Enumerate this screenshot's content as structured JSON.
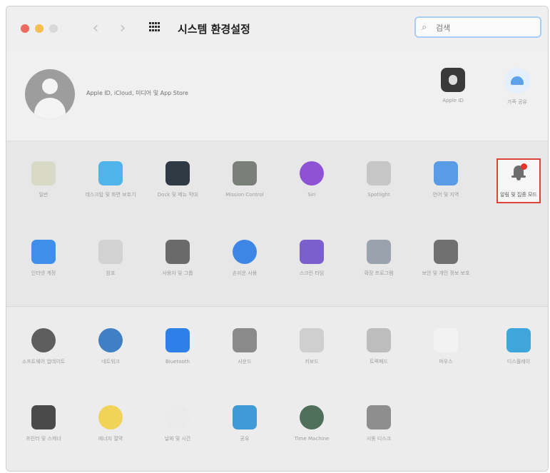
{
  "window": {
    "title": "시스템 환경설정",
    "back_glyph": "‹",
    "forward_glyph": "›"
  },
  "search": {
    "placeholder": "검색"
  },
  "account": {
    "description": "Apple ID, iCloud, 미디어 및 App Store",
    "icons": [
      {
        "label": "Apple ID",
        "icon": "apple-id-icon"
      },
      {
        "label": "가족 공유",
        "icon": "family-sharing-icon"
      }
    ]
  },
  "section1": {
    "row1": [
      {
        "label": "일반",
        "icon": "general-icon",
        "color": "#d9d9c8"
      },
      {
        "label": "데스크탑 및 화면 보호기",
        "icon": "desktop-screensaver-icon",
        "color": "#4fb4ea"
      },
      {
        "label": "Dock 및 메뉴 막대",
        "icon": "dock-menubar-icon",
        "color": "#2f3a45"
      },
      {
        "label": "Mission Control",
        "icon": "mission-control-icon",
        "color": "#7a7f7a"
      },
      {
        "label": "Siri",
        "icon": "siri-icon",
        "color": "#8e52d6"
      },
      {
        "label": "Spotlight",
        "icon": "spotlight-icon",
        "color": "#c6c6c6"
      },
      {
        "label": "언어 및 지역",
        "icon": "language-region-icon",
        "color": "#5a9be6"
      },
      {
        "label": "알림 및 집중 모드",
        "icon": "notifications-focus-icon",
        "color": "#6d6d6d"
      }
    ],
    "row2": [
      {
        "label": "인터넷 계정",
        "icon": "internet-accounts-icon",
        "color": "#3f8eea"
      },
      {
        "label": "암호",
        "icon": "passwords-icon",
        "color": "#d2d2d2"
      },
      {
        "label": "사용자 및 그룹",
        "icon": "users-groups-icon",
        "color": "#6a6a6a"
      },
      {
        "label": "손쉬운 사용",
        "icon": "accessibility-icon",
        "color": "#3d86e6"
      },
      {
        "label": "스크린 타임",
        "icon": "screen-time-icon",
        "color": "#7b5fcc"
      },
      {
        "label": "확장 프로그램",
        "icon": "extensions-icon",
        "color": "#9aa3ad"
      },
      {
        "label": "보안 및 개인 정보 보호",
        "icon": "security-privacy-icon",
        "color": "#6f6f6f"
      }
    ]
  },
  "section2": {
    "row1": [
      {
        "label": "소프트웨어 업데이트",
        "icon": "software-update-icon",
        "color": "#5e5e5e"
      },
      {
        "label": "네트워크",
        "icon": "network-icon",
        "color": "#3f7fc4"
      },
      {
        "label": "Bluetooth",
        "icon": "bluetooth-icon",
        "color": "#2f7fe8"
      },
      {
        "label": "사운드",
        "icon": "sound-icon",
        "color": "#8a8a8a"
      },
      {
        "label": "키보드",
        "icon": "keyboard-icon",
        "color": "#cfcfcf"
      },
      {
        "label": "트랙패드",
        "icon": "trackpad-icon",
        "color": "#bdbdbd"
      },
      {
        "label": "마우스",
        "icon": "mouse-icon",
        "color": "#f2f2f2"
      },
      {
        "label": "디스플레이",
        "icon": "displays-icon",
        "color": "#3fa6dc"
      }
    ],
    "row2": [
      {
        "label": "프린터 및 스캐너",
        "icon": "printers-scanners-icon",
        "color": "#4a4a4a"
      },
      {
        "label": "에너지 절약",
        "icon": "energy-saver-icon",
        "color": "#f2d35a"
      },
      {
        "label": "날짜 및 시간",
        "icon": "date-time-icon",
        "color": "#eaeaea"
      },
      {
        "label": "공유",
        "icon": "sharing-icon",
        "color": "#3f9ad6"
      },
      {
        "label": "Time Machine",
        "icon": "time-machine-icon",
        "color": "#4f6f5a"
      },
      {
        "label": "시동 디스크",
        "icon": "startup-disk-icon",
        "color": "#8e8e8e"
      }
    ]
  }
}
